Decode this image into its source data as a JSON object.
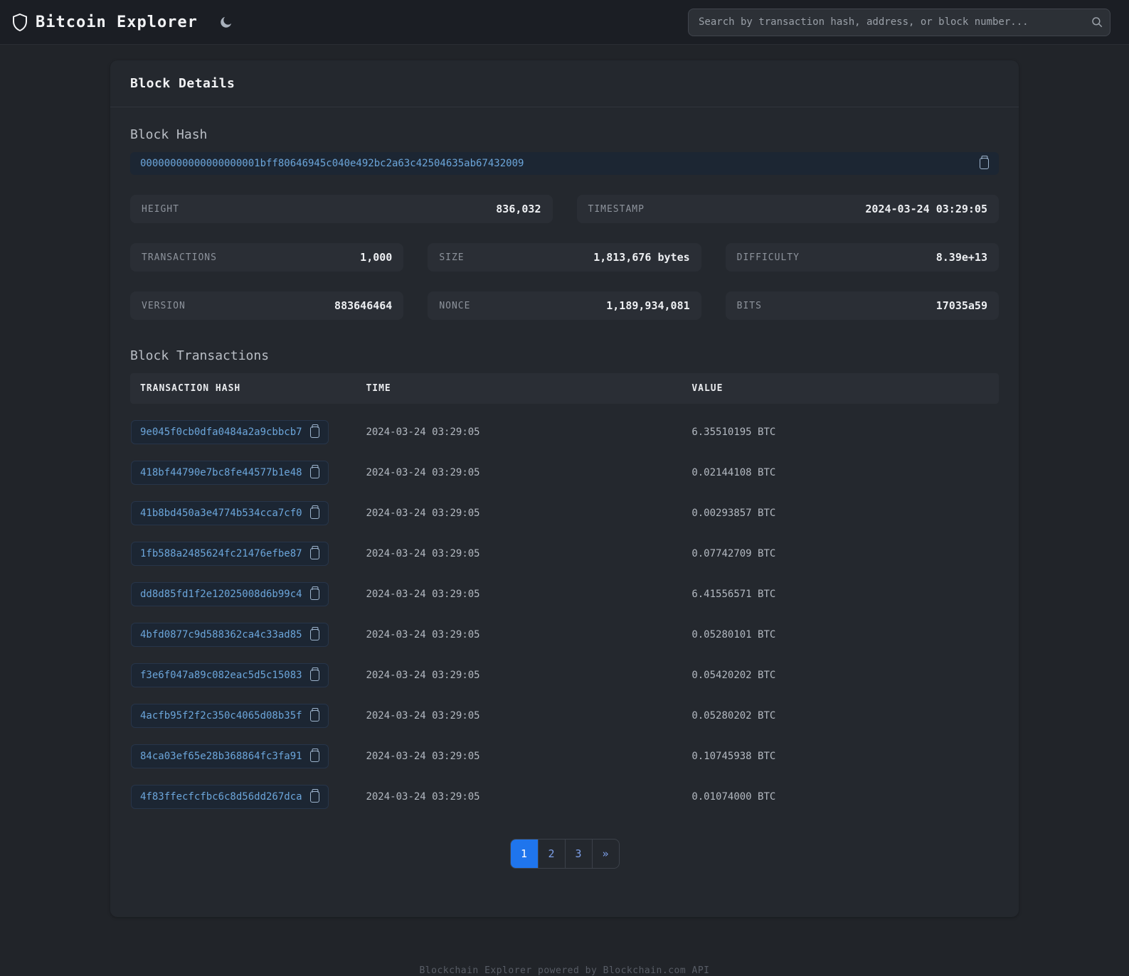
{
  "colors": {
    "accent_blue": "#1f75ed",
    "hash_link_blue": "#6ca6db",
    "page_background": "#212429",
    "card_background": "#24282e"
  },
  "header": {
    "app_title": "Bitcoin Explorer",
    "logo_icon": "shield-icon",
    "theme_icon": "moon-icon",
    "search": {
      "placeholder": "Search by transaction hash, address, or block number..."
    }
  },
  "block_details": {
    "title": "Block Details",
    "block_hash_label": "Block Hash",
    "block_hash": "00000000000000000001bff80646945c040e492bc2a63c42504635ab67432009",
    "stats_row1": [
      {
        "label": "HEIGHT",
        "value": "836,032"
      },
      {
        "label": "TIMESTAMP",
        "value": "2024-03-24 03:29:05"
      }
    ],
    "stats_row2": [
      {
        "label": "TRANSACTIONS",
        "value": "1,000"
      },
      {
        "label": "SIZE",
        "value": "1,813,676 bytes"
      },
      {
        "label": "DIFFICULTY",
        "value": "8.39e+13"
      }
    ],
    "stats_row3": [
      {
        "label": "VERSION",
        "value": "883646464"
      },
      {
        "label": "NONCE",
        "value": "1,189,934,081"
      },
      {
        "label": "BITS",
        "value": "17035a59"
      }
    ]
  },
  "transactions": {
    "title": "Block Transactions",
    "columns": [
      "TRANSACTION HASH",
      "TIME",
      "VALUE"
    ],
    "rows": [
      {
        "hash": "9e045f0cb0dfa0484a2a9cbbcb7…",
        "time": "2024-03-24 03:29:05",
        "value": "6.35510195 BTC"
      },
      {
        "hash": "418bf44790e7bc8fe44577b1e48…",
        "time": "2024-03-24 03:29:05",
        "value": "0.02144108 BTC"
      },
      {
        "hash": "41b8bd450a3e4774b534cca7cf0…",
        "time": "2024-03-24 03:29:05",
        "value": "0.00293857 BTC"
      },
      {
        "hash": "1fb588a2485624fc21476efbe87…",
        "time": "2024-03-24 03:29:05",
        "value": "0.07742709 BTC"
      },
      {
        "hash": "dd8d85fd1f2e12025008d6b99c4…",
        "time": "2024-03-24 03:29:05",
        "value": "6.41556571 BTC"
      },
      {
        "hash": "4bfd0877c9d588362ca4c33ad85…",
        "time": "2024-03-24 03:29:05",
        "value": "0.05280101 BTC"
      },
      {
        "hash": "f3e6f047a89c082eac5d5c15083…",
        "time": "2024-03-24 03:29:05",
        "value": "0.05420202 BTC"
      },
      {
        "hash": "4acfb95f2f2c350c4065d08b35f…",
        "time": "2024-03-24 03:29:05",
        "value": "0.05280202 BTC"
      },
      {
        "hash": "84ca03ef65e28b368864fc3fa91…",
        "time": "2024-03-24 03:29:05",
        "value": "0.10745938 BTC"
      },
      {
        "hash": "4f83ffecfcfbc6c8d56dd267dca…",
        "time": "2024-03-24 03:29:05",
        "value": "0.01074000 BTC"
      }
    ]
  },
  "pagination": {
    "pages": [
      "1",
      "2",
      "3"
    ],
    "active_page": "1",
    "next_label": "»"
  },
  "footer": {
    "text": "Blockchain Explorer powered by Blockchain.com API"
  }
}
